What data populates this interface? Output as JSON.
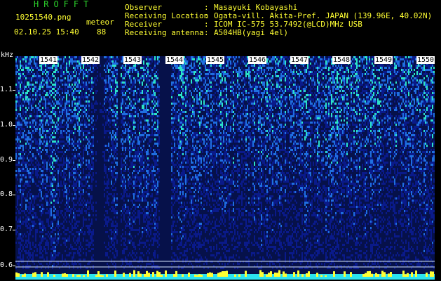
{
  "header": {
    "title": "HROFFT",
    "filename": "10251540.png",
    "meteor_label": "meteor",
    "datetime": "02.10.25 15:40",
    "meteor_count": "88"
  },
  "info": [
    {
      "label": "Observer",
      "value": "Masayuki Kobayashi"
    },
    {
      "label": "Receiving Location",
      "value": "Ogata-vill. Akita-Pref. JAPAN (139.96E, 40.02N)"
    },
    {
      "label": "Receiver",
      "value": "ICOM IC-575 53.7492(@LCD)MHz USB"
    },
    {
      "label": "Receiving antenna",
      "value": "A504HB(yagi 4el)"
    }
  ],
  "separator": ":",
  "chart_data": {
    "type": "heatmap",
    "ylabel": "kHz",
    "y_ticks": [
      "1.1",
      "1.0",
      "0.9",
      "0.8",
      "0.7",
      "0.6"
    ],
    "x_ticks": [
      "1541",
      "1542",
      "1543",
      "1544",
      "1545",
      "1546",
      "1547",
      "1548",
      "1549",
      "1550"
    ],
    "colors": {
      "background": "#000000",
      "low": "#0a1a8a",
      "mid": "#1f6fe0",
      "high": "#2be3c8",
      "peak": "#ffff33",
      "baseline": "#2be3f0"
    }
  }
}
